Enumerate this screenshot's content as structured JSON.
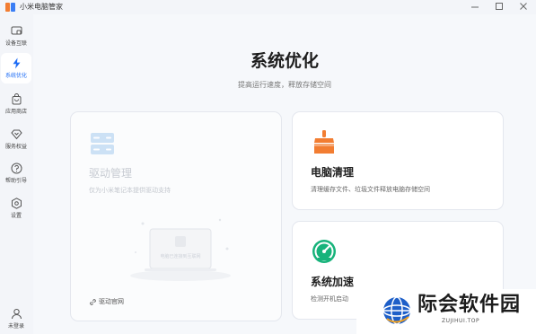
{
  "window": {
    "title": "小米电脑管家"
  },
  "sidebar": {
    "items": [
      {
        "label": "设备互联",
        "icon": "device-link-icon"
      },
      {
        "label": "系统优化",
        "icon": "lightning-icon",
        "active": true
      },
      {
        "label": "应用商店",
        "icon": "shopping-bag-icon"
      },
      {
        "label": "服务权益",
        "icon": "diamond-icon"
      },
      {
        "label": "帮助引导",
        "icon": "question-icon"
      },
      {
        "label": "设置",
        "icon": "settings-icon"
      }
    ],
    "login_label": "未登录"
  },
  "main": {
    "title": "系统优化",
    "subtitle": "提高运行速度，释放存储空间"
  },
  "cards": {
    "driver": {
      "title": "驱动管理",
      "desc": "仅为小米笔记本提供驱动支持",
      "link_label": "驱动官网",
      "illustration_text": "电脑已连接到互联网"
    },
    "clean": {
      "title": "电脑清理",
      "desc": "清理缓存文件、垃圾文件释放电脑存储空间"
    },
    "speed": {
      "title": "系统加速",
      "desc": "检测开机启动"
    }
  },
  "watermark": {
    "text": "际会软件园",
    "sub": "ZUJIHUI.TOP"
  },
  "colors": {
    "accent": "#1d6cf5",
    "broom": "#f27d32",
    "gauge": "#17b37b",
    "driver_icon": "#9fc7ef"
  }
}
